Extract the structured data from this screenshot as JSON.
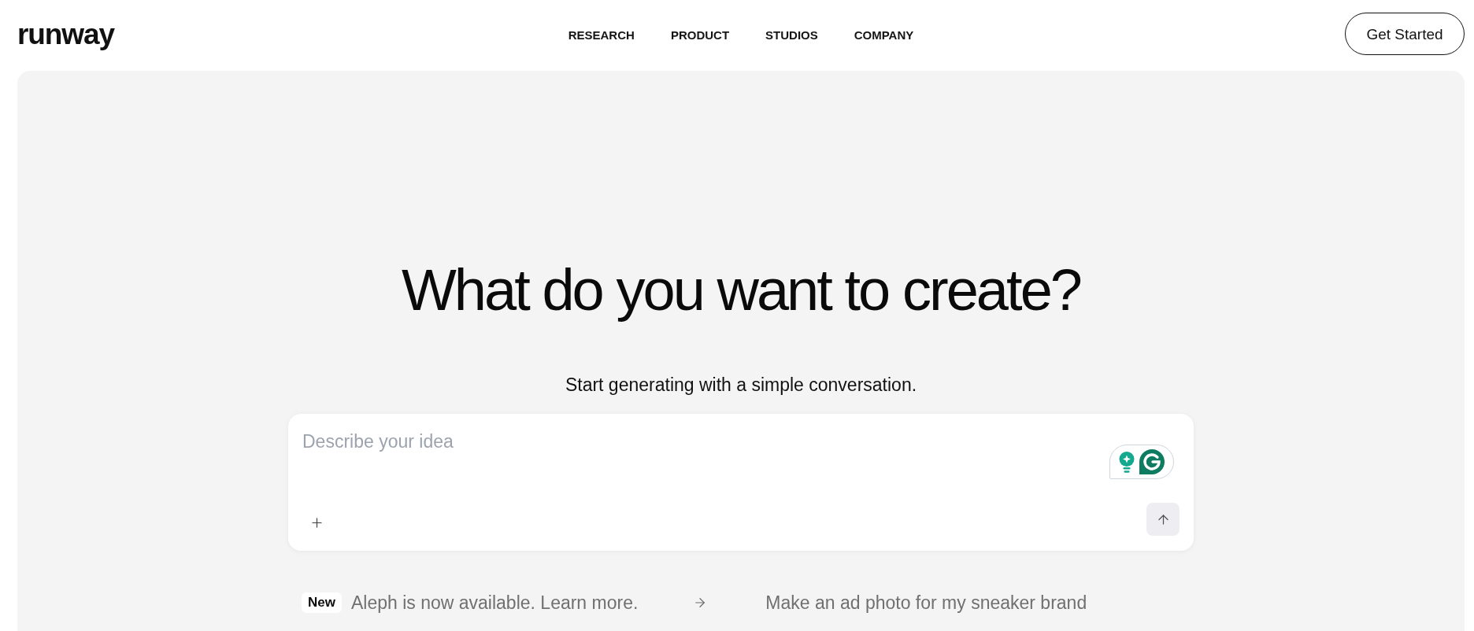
{
  "header": {
    "logo": "runway",
    "nav": [
      "RESEARCH",
      "PRODUCT",
      "STUDIOS",
      "COMPANY"
    ],
    "cta": "Get Started"
  },
  "hero": {
    "title": "What do you want to create?",
    "subtitle": "Start generating with a simple conversation."
  },
  "prompt_box": {
    "placeholder": "Describe your idea"
  },
  "announcement": {
    "badge": "New",
    "text": "Aleph is now available. Learn more."
  },
  "suggestions": [
    "Make an ad photo for my sneaker brand"
  ]
}
